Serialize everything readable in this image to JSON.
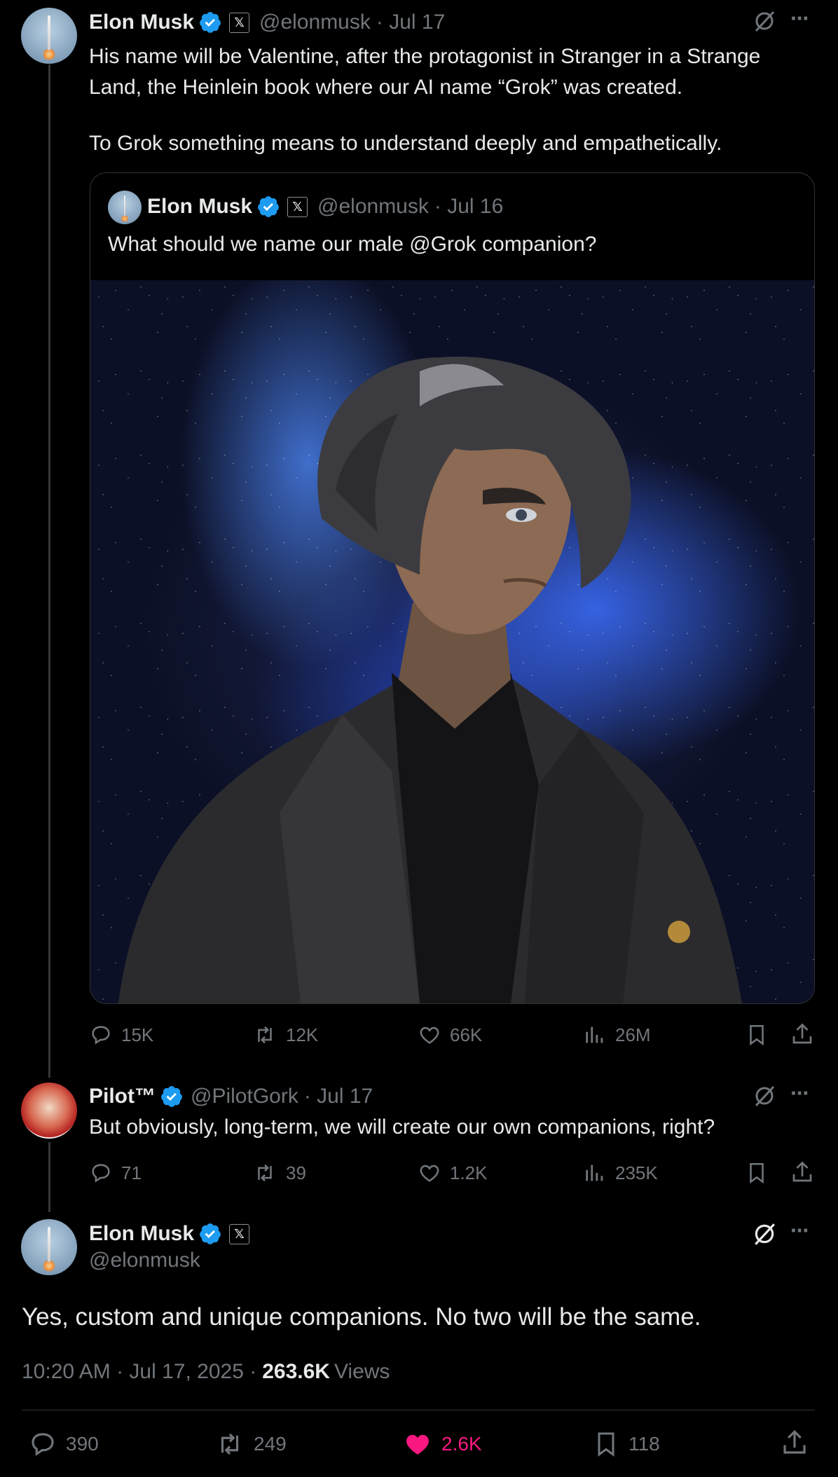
{
  "tweet1": {
    "name": "Elon Musk",
    "handle": "@elonmusk",
    "date": "· Jul 17",
    "text_line1": "His name will be Valentine, after the protagonist in Stranger in a Strange",
    "text_line2": "Land, the Heinlein book where our AI name “Grok” was created.",
    "text_line3": "To Grok something means to understand deeply and empathetically.",
    "quote": {
      "name": "Elon Musk",
      "handle": "@elonmusk",
      "date": "· Jul 16",
      "text": "What should we name our male @Grok companion?"
    },
    "actions": {
      "replies": "15K",
      "reposts": "12K",
      "likes": "66K",
      "views": "26M"
    }
  },
  "tweet2": {
    "name": "Pilot™",
    "handle": "@PilotGork",
    "date": "· Jul 17",
    "text": "But obviously, long-term, we will create our own companions, right?",
    "actions": {
      "replies": "71",
      "reposts": "39",
      "likes": "1.2K",
      "views": "235K"
    }
  },
  "main": {
    "name": "Elon Musk",
    "handle": "@elonmusk",
    "text": "Yes, custom and unique companions. No two will be the same.",
    "timestamp": "10:20 AM · Jul 17, 2025 ·",
    "views_count": "263.6K",
    "views_label": "Views",
    "actions": {
      "replies": "390",
      "reposts": "249",
      "likes": "2.6K",
      "bookmarks": "118"
    }
  },
  "icons": {
    "x_badge": "𝕏",
    "more": "···"
  },
  "colors": {
    "verified": "#1d9bf0",
    "like_active": "#f91880",
    "muted": "#71767b"
  }
}
